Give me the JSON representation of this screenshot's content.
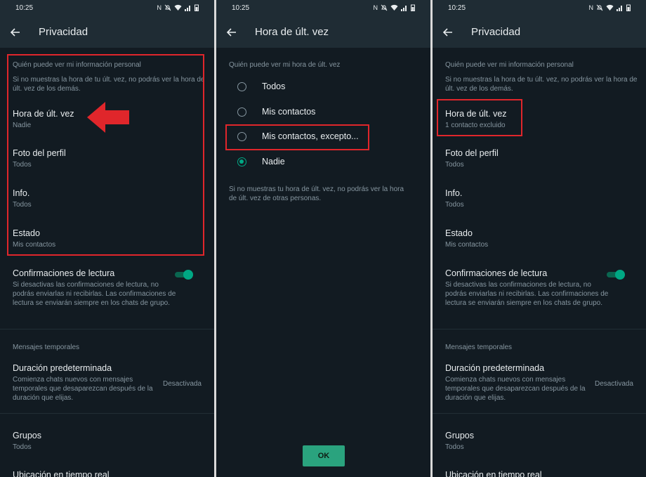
{
  "status": {
    "time": "10:25",
    "icons": [
      "nfc-icon",
      "mute-icon",
      "wifi-icon",
      "signal-icon",
      "battery-icon"
    ]
  },
  "panel1": {
    "title": "Privacidad",
    "section_title": "Quién puede ver mi información personal",
    "section_desc": "Si no muestras la hora de tu últ. vez, no podrás ver la hora de últ. vez de los demás.",
    "last_seen": {
      "title": "Hora de últ. vez",
      "value": "Nadie"
    },
    "profile_photo": {
      "title": "Foto del perfil",
      "value": "Todos"
    },
    "info": {
      "title": "Info.",
      "value": "Todos"
    },
    "status": {
      "title": "Estado",
      "value": "Mis contactos"
    },
    "read_receipts": {
      "title": "Confirmaciones de lectura",
      "desc": "Si desactivas las confirmaciones de lectura, no podrás enviarlas ni recibirlas. Las confirmaciones de lectura se enviarán siempre en los chats de grupo.",
      "enabled": true
    },
    "temp_section": "Mensajes temporales",
    "default_duration": {
      "title": "Duración predeterminada",
      "desc": "Comienza chats nuevos con mensajes temporales que desaparezcan después de la duración que elijas.",
      "value": "Desactivada"
    },
    "groups": {
      "title": "Grupos",
      "value": "Todos"
    },
    "live_location": {
      "title": "Ubicación en tiempo real"
    }
  },
  "panel2": {
    "title": "Hora de últ. vez",
    "section_title": "Quién puede ver mi hora de últ. vez",
    "options": [
      "Todos",
      "Mis contactos",
      "Mis contactos, excepto...",
      "Nadie"
    ],
    "selected_index": 3,
    "footer": "Si no muestras tu hora de últ. vez, no podrás ver la hora de últ. vez de otras personas.",
    "ok_label": "OK"
  },
  "panel3": {
    "title": "Privacidad",
    "section_title": "Quién puede ver mi información personal",
    "section_desc": "Si no muestras la hora de tu últ. vez, no podrás ver la hora de últ. vez de los demás.",
    "last_seen": {
      "title": "Hora de últ. vez",
      "value": "1 contacto excluido"
    },
    "profile_photo": {
      "title": "Foto del perfil",
      "value": "Todos"
    },
    "info": {
      "title": "Info.",
      "value": "Todos"
    },
    "status": {
      "title": "Estado",
      "value": "Mis contactos"
    },
    "read_receipts": {
      "title": "Confirmaciones de lectura",
      "desc": "Si desactivas las confirmaciones de lectura, no podrás enviarlas ni recibirlas. Las confirmaciones de lectura se enviarán siempre en los chats de grupo.",
      "enabled": true
    },
    "temp_section": "Mensajes temporales",
    "default_duration": {
      "title": "Duración predeterminada",
      "desc": "Comienza chats nuevos con mensajes temporales que desaparezcan después de la duración que elijas.",
      "value": "Desactivada"
    },
    "groups": {
      "title": "Grupos",
      "value": "Todos"
    },
    "live_location": {
      "title": "Ubicación en tiempo real"
    }
  },
  "colors": {
    "background": "#121b22",
    "appbar": "#1f2c34",
    "accent": "#00a884",
    "highlight": "#e0262b"
  }
}
